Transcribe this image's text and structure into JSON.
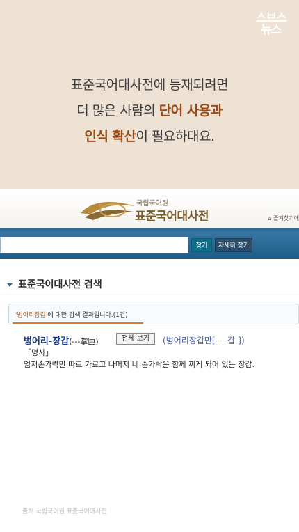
{
  "caption": {
    "logo_line1": "스브스",
    "logo_line2": "뉴스",
    "line1": "표준국어대사전에 등재되려면",
    "line2_pre": "더 많은 사람의 ",
    "line2_hl": "단어 사용과",
    "line3_hl": "인식 확산",
    "line3_post": "이 필요하대요."
  },
  "site": {
    "org": "국립국어원",
    "title": "표준국어대사전",
    "favorite": "즐겨찾기에"
  },
  "search": {
    "input_value": "",
    "search_button": "찾기",
    "detail_button": "자세히 찾기"
  },
  "section": {
    "title": "표준국어대사전 검색"
  },
  "result": {
    "query": "'벙어리장갑'",
    "summary": "에 대한 검색 결과입니다.(1건)"
  },
  "entry": {
    "word": "벙어리-장갑",
    "hanja": "(---掌匣)",
    "full_view_button": "전체 보기",
    "related": "(벙어리장갑만[----갑-])",
    "pos": "「명사」",
    "definition": "엄지손가락만 따로 가르고 나머지 네 손가락은 함께 끼게 되어 있는 장갑."
  },
  "source": "출처 국립국어원 표준국어대사전",
  "colors": {
    "caption_bg": "#ede2d4",
    "highlight": "#9a4a12",
    "searchbar": "#1f5d88",
    "accent_orange": "#e2782a"
  }
}
